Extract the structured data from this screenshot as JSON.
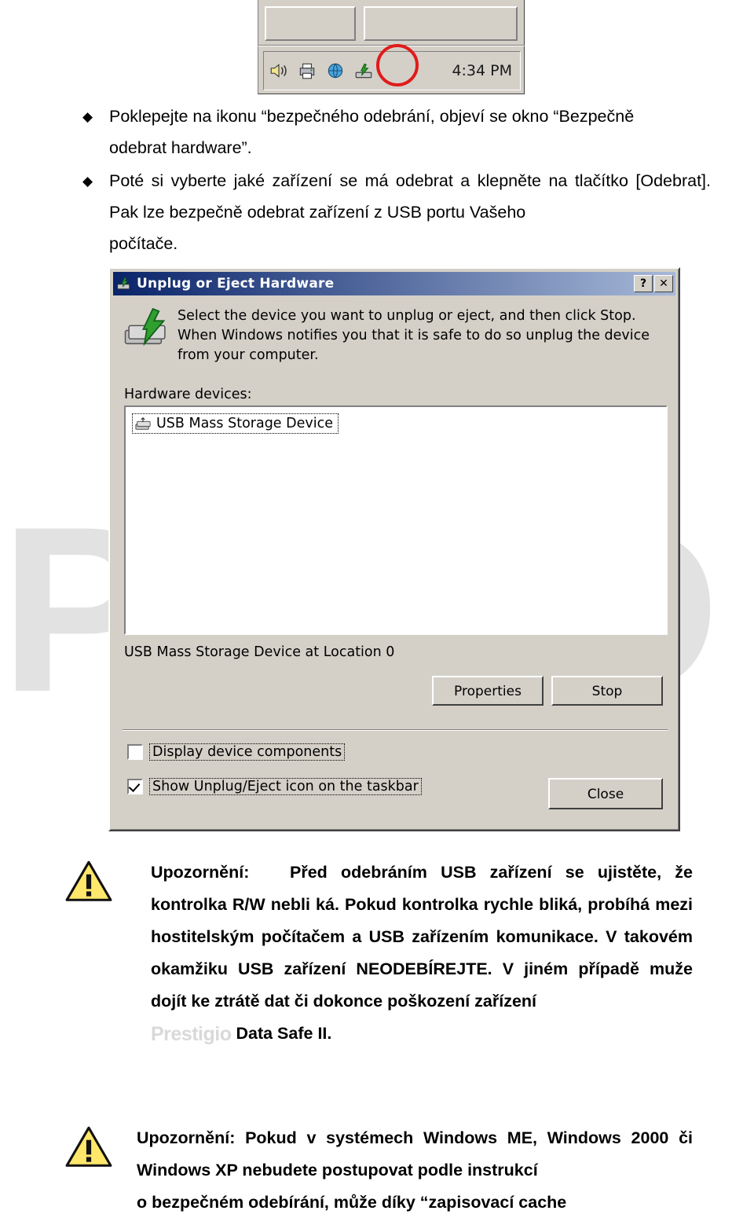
{
  "taskbar": {
    "time": "4:34 PM",
    "icons": [
      "speaker-icon",
      "printer-icon",
      "network-icon",
      "safely-remove-hardware-icon"
    ],
    "highlight": "red-circle-highlight"
  },
  "bullets": [
    {
      "marker": "◆",
      "text": "Poklepejte na ikonu “bezpečného odebrání, objeví se okno “Bezpečně",
      "tail": "odebrat hardware”."
    },
    {
      "marker": "◆",
      "text": "Poté si vyberte jaké zařízení se má odebrat a klepněte na tlačítko [Odebrat]. Pak lze bezpečně odebrat zařízení z USB portu Vašeho",
      "tail": "počítače."
    }
  ],
  "dialog": {
    "title": "Unplug or Eject Hardware",
    "title_buttons": [
      "?",
      "✕"
    ],
    "description": "Select the device you want to unplug or eject, and then click Stop. When Windows notifies you that it is safe to do so unplug the device from your computer.",
    "hardware_devices_label": "Hardware devices:",
    "devices": [
      {
        "label": "USB Mass Storage Device",
        "icon": "usb-storage-icon"
      }
    ],
    "status": "USB Mass Storage Device at Location 0",
    "buttons": {
      "properties": "Properties",
      "stop": "Stop",
      "close": "Close"
    },
    "checkboxes": [
      {
        "label": "Display device components",
        "checked": false
      },
      {
        "label": "Show Unplug/Eject icon on the taskbar",
        "checked": true
      }
    ]
  },
  "notes": [
    {
      "icon": "warning-triangle-icon",
      "text": "Upozornění:   Před odebráním USB zařízení se ujistěte, že kontrolka R/W nebli ká. Pokud kontrolka rychle bliká, probíhá mezi hostitelským počítačem a USB zařízením komunikace. V takovém okamžiku USB zařízení NEODEBÍREJTE. V jiném případě muže dojít ke ztrátě dat či dokonce poškození zařízení",
      "watermark": "Prestigio",
      "last_line": "Data Safe II."
    },
    {
      "icon": "warning-triangle-icon",
      "text": "Upozornění: Pokud v systémech Windows ME, Windows 2000 či Windows XP nebudete postupovat podle instrukcí",
      "last_line": "o bezpečném odebírání, může díky “zapisovací cache"
    }
  ],
  "watermark": {
    "letters": "PD"
  },
  "colors": {
    "dialog_face": "#d4d0c8",
    "title_gradient_start": "#0a246a",
    "highlight_red": "#e01b1b",
    "watermark_gray": "#e2e2e2"
  }
}
